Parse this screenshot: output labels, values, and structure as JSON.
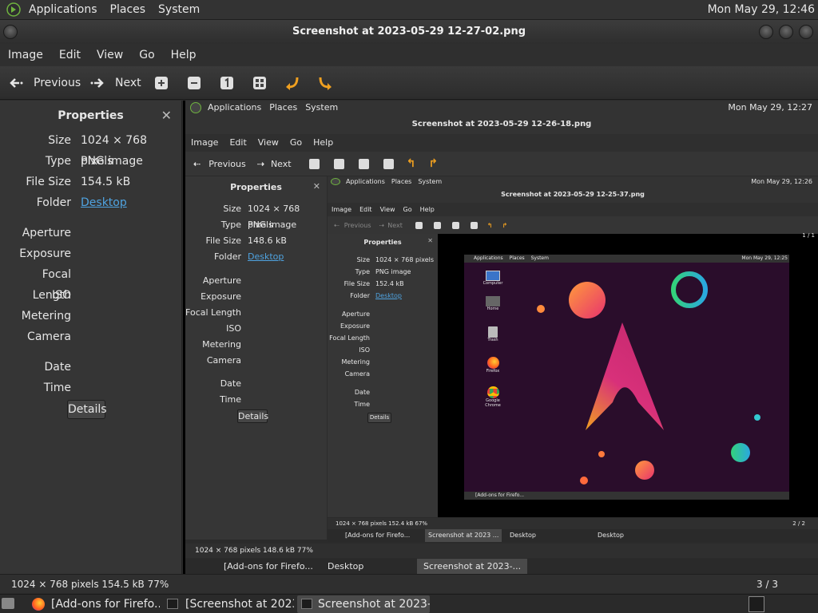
{
  "top_panel": {
    "menus": [
      "Applications",
      "Places",
      "System"
    ],
    "clock": "Mon May 29, 12:46"
  },
  "window": {
    "title": "Screenshot at 2023-05-29 12-27-02.png"
  },
  "menubar": [
    "Image",
    "Edit",
    "View",
    "Go",
    "Help"
  ],
  "toolbar": {
    "previous_label": "Previous",
    "next_label": "Next"
  },
  "sidebar": {
    "title": "Properties",
    "close_glyph": "✕",
    "size_label": "Size",
    "size_value": "1024 × 768 pixels",
    "type_label": "Type",
    "type_value": "PNG image",
    "filesize_label": "File Size",
    "filesize_value": "154.5 kB",
    "folder_label": "Folder",
    "folder_value": "Desktop",
    "aperture_label": "Aperture",
    "exposure_label": "Exposure",
    "focal_label": "Focal Length",
    "iso_label": "ISO",
    "metering_label": "Metering",
    "camera_label": "Camera",
    "date_label": "Date",
    "time_label": "Time",
    "details_label": "Details"
  },
  "statusbar": {
    "info": "1024 × 768 pixels  154.5 kB   77%",
    "count": "3 / 3"
  },
  "taskbar": {
    "tasks": [
      "[Add-ons for Firefo...",
      "[Screenshot at 2023-...",
      "Screenshot at 2023-..."
    ]
  },
  "nested1": {
    "menus": [
      "Applications",
      "Places",
      "System"
    ],
    "clock": "Mon May 29, 12:27",
    "title": "Screenshot at 2023-05-29 12-26-18.png",
    "menubar": [
      "Image",
      "Edit",
      "View",
      "Go",
      "Help"
    ],
    "previous_label": "Previous",
    "next_label": "Next",
    "props_title": "Properties",
    "size_value": "1024 × 768 pixels",
    "type_value": "PNG image",
    "filesize_value": "148.6 kB",
    "folder_value": "Desktop",
    "details_label": "Details",
    "status": "1024 × 768 pixels  148.6 kB   77%",
    "tasks": [
      "[Add-ons for Firefo...",
      "Desktop",
      "Screenshot at 2023-..."
    ]
  },
  "nested2": {
    "menus": [
      "Applications",
      "Places",
      "System"
    ],
    "clock": "Mon May 29, 12:26",
    "title": "Screenshot at 2023-05-29 12-25-37.png",
    "menubar": [
      "Image",
      "Edit",
      "View",
      "Go",
      "Help"
    ],
    "previous_label": "Previous",
    "next_label": "Next",
    "props_title": "Properties",
    "size_value": "1024 × 768 pixels",
    "type_value": "PNG image",
    "filesize_value": "152.4 kB",
    "folder_value": "Desktop",
    "details_label": "Details",
    "status": "1024 × 768 pixels  152.4 kB   67%",
    "count_top": "1 / 1",
    "count_bottom": "2 / 2",
    "tasks": [
      "[Add-ons for Firefo...",
      "Screenshot at 2023 ...",
      "Desktop",
      "Desktop"
    ]
  },
  "desktop": {
    "menus": [
      "Applications",
      "Places",
      "System"
    ],
    "clock": "Mon May 29, 12:25",
    "icons": [
      "Computer",
      "Home",
      "Trash",
      "Firefox",
      "Google Chrome"
    ],
    "task": "[Add-ons for Firefo..."
  },
  "colors": {
    "link": "#4fa3e0",
    "arrow_orange": "#f0a020",
    "desktop_bg": "#2a0d2b"
  }
}
